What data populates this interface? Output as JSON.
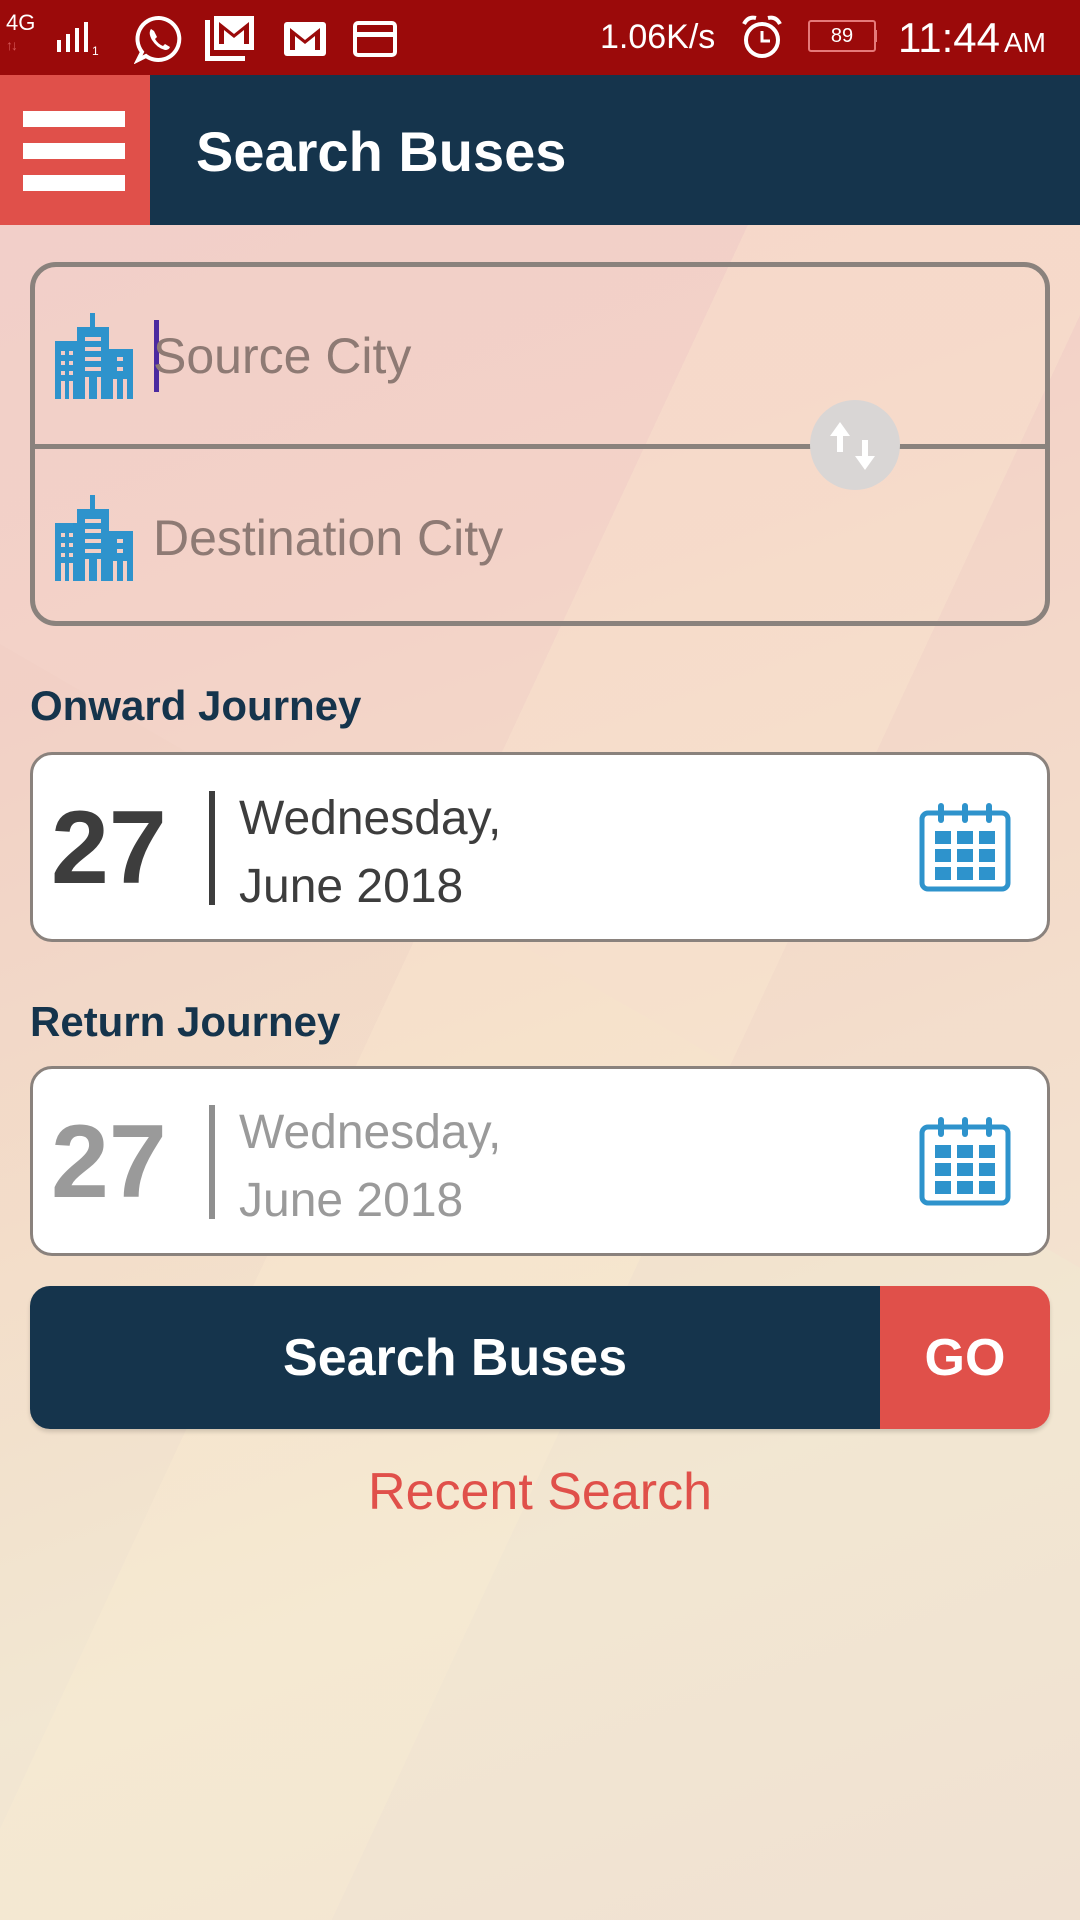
{
  "status_bar": {
    "network_type": "4G",
    "sim_indicator": "1",
    "notification_icons": [
      "whatsapp-icon",
      "gmail-stack-icon",
      "gmail-icon",
      "card-icon"
    ],
    "net_speed": "1.06K/s",
    "alarm_icon": "alarm-icon",
    "battery_level": "89",
    "time": "11:44",
    "ampm": "AM"
  },
  "app_bar": {
    "menu_icon": "hamburger-menu-icon",
    "title": "Search Buses"
  },
  "city_form": {
    "source_placeholder": "Source City",
    "source_value": "",
    "destination_placeholder": "Destination City",
    "destination_value": "",
    "city_icon": "city-buildings-icon",
    "swap_icon": "swap-vertical-icon"
  },
  "onward": {
    "label": "Onward Journey",
    "day": "27",
    "weekday": "Wednesday,",
    "month_year": "June 2018",
    "icon": "calendar-icon"
  },
  "return": {
    "label": "Return Journey",
    "day": "27",
    "weekday": "Wednesday,",
    "month_year": "June 2018",
    "icon": "calendar-icon"
  },
  "actions": {
    "search_label": "Search Buses",
    "go_label": "GO",
    "recent_search_label": "Recent Search"
  },
  "colors": {
    "status_bar": "#9b0a0a",
    "app_bar": "#15344c",
    "accent_red": "#e0504a",
    "icon_blue": "#2e93cc"
  }
}
